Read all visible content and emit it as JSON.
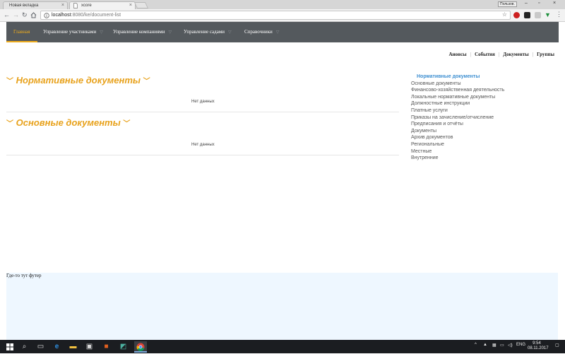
{
  "browser": {
    "tabs": [
      {
        "label": "Новая вкладка"
      },
      {
        "label": "xcore"
      }
    ],
    "user_label": "Пользов.",
    "url_host": "localhost",
    "url_path": ":8080/ke/document-list"
  },
  "nav": {
    "items": [
      {
        "label": "Главная"
      },
      {
        "label": "Управление участниками"
      },
      {
        "label": "Управление компаниями"
      },
      {
        "label": "Управление садами"
      },
      {
        "label": "Справочники"
      }
    ]
  },
  "toplinks": [
    "Анонсы",
    "События",
    "Документы",
    "Группы"
  ],
  "sections": [
    {
      "title": "Нормативные документы",
      "empty_text": "Нет данных"
    },
    {
      "title": "Основные документы",
      "empty_text": "Нет данных"
    }
  ],
  "sidebar": {
    "heading": "Нормативные документы",
    "items": [
      "Основные документы",
      "Финансово-хозяйственная деятельность",
      "Локальные нормативные документы",
      "Должностные инструкции",
      "Платные услуги",
      "Приказы на зачисление/отчисление",
      "Предписания и отчёты",
      "Документы",
      "Архив документов",
      "Региональные",
      "Местные",
      "Внутренние"
    ]
  },
  "footer": {
    "text": "Где-то тут футер"
  },
  "taskbar": {
    "lang": "ENG",
    "time": "9:54",
    "date": "08.11.2017"
  },
  "colors": {
    "accent": "#e8a21c",
    "navbar": "#54595d",
    "link_blue": "#3d8fd1",
    "footer_bg": "#eef7ff"
  }
}
